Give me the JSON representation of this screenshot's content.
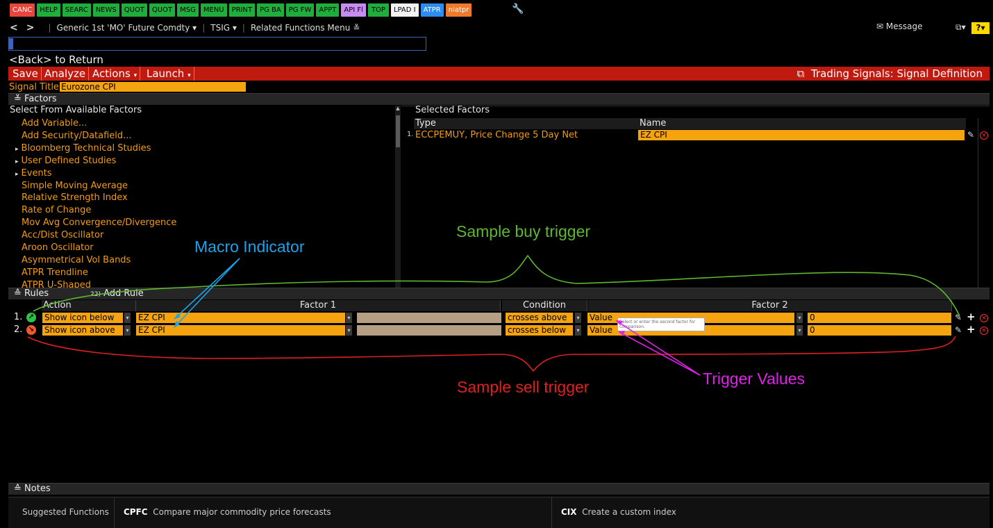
{
  "function_keys": [
    {
      "label": "CANC",
      "style": "k-red"
    },
    {
      "label": "HELP",
      "style": "k-green"
    },
    {
      "label": "SEARC",
      "style": "k-green"
    },
    {
      "label": "NEWS",
      "style": "k-green"
    },
    {
      "label": "QUOT",
      "style": "k-green"
    },
    {
      "label": "QUOT",
      "style": "k-green"
    },
    {
      "label": "MSG",
      "style": "k-green"
    },
    {
      "label": "MENU",
      "style": "k-green"
    },
    {
      "label": "PRINT",
      "style": "k-green"
    },
    {
      "label": "PG BA",
      "style": "k-green"
    },
    {
      "label": "PG FW",
      "style": "k-green"
    },
    {
      "label": "APPT",
      "style": "k-green"
    },
    {
      "label": "API Fl",
      "style": "k-purple"
    },
    {
      "label": "TOP",
      "style": "k-green"
    },
    {
      "label": "LPAD I",
      "style": "k-white"
    },
    {
      "label": "ATPR",
      "style": "k-blue"
    },
    {
      "label": "niatpr",
      "style": "k-orange"
    }
  ],
  "nav": {
    "security": "Generic 1st 'MO' Future Comdty",
    "function": "TSIG",
    "related": "Related Functions Menu",
    "message": "Message"
  },
  "back_text": "<Back> to Return",
  "toolbar": {
    "save": "Save",
    "analyze": "Analyze",
    "actions": "Actions",
    "launch": "Launch",
    "screen_title": "Trading Signals: Signal Definition"
  },
  "signal_title": {
    "label": "Signal Title",
    "value": "Eurozone CPI"
  },
  "factors_section": {
    "label": "Factors",
    "available_header": "Select From Available Factors",
    "available": [
      {
        "label": "Add Variable...",
        "expandable": false
      },
      {
        "label": "Add Security/Datafield...",
        "expandable": false
      },
      {
        "label": "Bloomberg Technical Studies",
        "expandable": true
      },
      {
        "label": "User Defined Studies",
        "expandable": true
      },
      {
        "label": "Events",
        "expandable": true
      },
      {
        "label": "Simple Moving Average",
        "expandable": false
      },
      {
        "label": "Relative Strength Index",
        "expandable": false
      },
      {
        "label": "Rate of Change",
        "expandable": false
      },
      {
        "label": "Mov Avg Convergence/Divergence",
        "expandable": false
      },
      {
        "label": "Acc/Dist Oscillator",
        "expandable": false
      },
      {
        "label": "Aroon Oscillator",
        "expandable": false
      },
      {
        "label": "Asymmetrical Vol Bands",
        "expandable": false
      },
      {
        "label": "ATPR Trendline",
        "expandable": false
      },
      {
        "label": "ATPR U-Shaped",
        "expandable": false
      }
    ],
    "selected_header": "Selected Factors",
    "col_type": "Type",
    "col_name": "Name",
    "selected": [
      {
        "num": "1.",
        "type": "ECCPEMUY, Price Change 5 Day Net",
        "name": "EZ CPI"
      }
    ]
  },
  "rules_section": {
    "label": "Rules",
    "add_rule": "Add Rule",
    "col_action": "Action",
    "col_factor1": "Factor 1",
    "col_condition": "Condition",
    "col_factor2": "Factor 2",
    "rows": [
      {
        "num": "1.",
        "signal": "buy",
        "action": "Show icon below",
        "factor1": "EZ CPI",
        "condition": "crosses above",
        "factor2_type": "Value",
        "value": "0"
      },
      {
        "num": "2.",
        "signal": "sell",
        "action": "Show icon above",
        "factor1": "EZ CPI",
        "condition": "crosses below",
        "factor2_type": "Value",
        "value": "0"
      }
    ],
    "tooltip": "Select or enter the second factor for comparison."
  },
  "notes_label": "Notes",
  "suggested": {
    "label": "Suggested Functions",
    "items": [
      {
        "code": "CPFC",
        "desc": "Compare major commodity price forecasts"
      },
      {
        "code": "CIX",
        "desc": "Create a custom index"
      }
    ]
  },
  "annotations": {
    "macro_indicator": "Macro Indicator",
    "buy_trigger": "Sample buy trigger",
    "sell_trigger": "Sample sell trigger",
    "trigger_values": "Trigger Values"
  },
  "colors": {
    "accent_orange": "#f5a30f",
    "toolbar_red": "#c0190f",
    "annot_blue": "#1aa3e8",
    "annot_green": "#5cb82e",
    "annot_red": "#e02020",
    "annot_magenta": "#e020e8"
  }
}
